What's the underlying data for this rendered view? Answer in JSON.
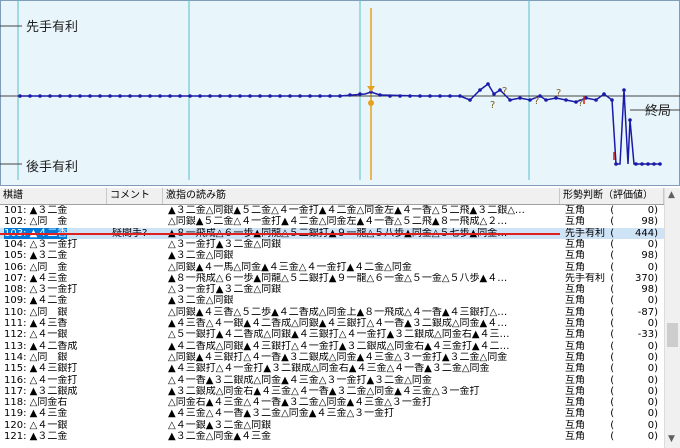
{
  "graph": {
    "label_top": "先手有利",
    "label_bottom": "後手有利",
    "label_end": "終局"
  },
  "table": {
    "headers": [
      "棋譜",
      "コメント",
      "激指の読み筋",
      "形勢判断（評価値）"
    ],
    "rows": [
      {
        "move": "101: ▲３二金",
        "comment": "",
        "pv": "▲３二金△同銀▲５二金△４一金打▲４二金△同金左▲４一香△５二飛▲３二銀△…",
        "eval": "互角",
        "num": "0"
      },
      {
        "move": "102: △同　金",
        "comment": "",
        "pv": "△同銀▲５二金△４一金打▲４二金△同金左▲４一香△５二飛▲８一飛成△２…",
        "eval": "互角",
        "num": "98"
      },
      {
        "move": "103: ▲４二香",
        "comment": "疑問手?",
        "pv": "▲８一飛成△６一歩▲同龍△５二銀打▲９一龍△５八歩▲同金△５七歩▲同金…",
        "eval": "先手有利",
        "num": "444",
        "selected": true
      },
      {
        "move": "104: △３一金打",
        "comment": "",
        "pv": "△３一金打▲３二金△同銀",
        "eval": "互角",
        "num": "0"
      },
      {
        "move": "105: ▲３二金",
        "comment": "",
        "pv": "▲３二金△同銀",
        "eval": "互角",
        "num": "98"
      },
      {
        "move": "106: △同　金",
        "comment": "",
        "pv": "△同銀▲４一馬△同金▲４三金△４一金打▲４二金△同金",
        "eval": "互角",
        "num": "0"
      },
      {
        "move": "107: ▲４三金",
        "comment": "",
        "pv": "▲８一飛成△６一歩▲同龍△５二銀打▲９一龍△６一金△５一金△５八歩▲４…",
        "eval": "先手有利",
        "num": "370"
      },
      {
        "move": "108: △３一金打",
        "comment": "",
        "pv": "△３一金打▲３二金△同銀",
        "eval": "互角",
        "num": "98"
      },
      {
        "move": "109: ▲４二金",
        "comment": "",
        "pv": "▲３二金△同銀",
        "eval": "互角",
        "num": "0"
      },
      {
        "move": "110: △同　銀",
        "comment": "",
        "pv": "△同銀▲４三香△５二歩▲４二香成△同金上▲８一飛成△４一香▲４三銀打△…",
        "eval": "互角",
        "num": "-87"
      },
      {
        "move": "111: ▲４三香",
        "comment": "",
        "pv": "▲４三香△４一銀▲４二香成△同銀▲４三銀打△４一香▲３二銀成△同金▲４…",
        "eval": "互角",
        "num": "0"
      },
      {
        "move": "112: △４一銀",
        "comment": "",
        "pv": "△５一銀打▲４二香成△同銀▲４三銀打△４一金打▲３二銀成△同金右▲４三…",
        "eval": "互角",
        "num": "-33"
      },
      {
        "move": "113: ▲４二香成",
        "comment": "",
        "pv": "▲４二香成△同銀▲４三銀打△４一金打▲３二銀成△同金右▲４三金打▲４二…",
        "eval": "互角",
        "num": "0"
      },
      {
        "move": "114: △同　銀",
        "comment": "",
        "pv": "△同銀▲４三銀打△４一香▲３二銀成△同金▲４三金△３一金打▲３二金△同金",
        "eval": "互角",
        "num": "0"
      },
      {
        "move": "115: ▲４三銀打",
        "comment": "",
        "pv": "▲４三銀打△４一金打▲３二銀成△同金右▲４三金△４一香▲３二金△同金",
        "eval": "互角",
        "num": "0"
      },
      {
        "move": "116: △４一金打",
        "comment": "",
        "pv": "△４一香▲３二銀成△同金▲４三金△３一金打▲３二金△同金",
        "eval": "互角",
        "num": "0"
      },
      {
        "move": "117: ▲３二銀成",
        "comment": "",
        "pv": "▲３二銀成△同金右▲４三金△４一香▲３二金△同金▲４三金△３一金打",
        "eval": "互角",
        "num": "0"
      },
      {
        "move": "118: △同金右",
        "comment": "",
        "pv": "△同金右▲４三金△４一香▲３二金△同金▲４三金△３一金打",
        "eval": "互角",
        "num": "0"
      },
      {
        "move": "119: ▲４三金",
        "comment": "",
        "pv": "▲４三金△４一香▲３二金△同金▲４三金△３一金打",
        "eval": "互角",
        "num": "0"
      },
      {
        "move": "120: △４一銀",
        "comment": "",
        "pv": "△４一銀▲３二金△同銀",
        "eval": "互角",
        "num": "0"
      },
      {
        "move": "121: ▲３二金",
        "comment": "",
        "pv": "▲３二金△同金▲４三金",
        "eval": "互角",
        "num": "0"
      }
    ]
  },
  "colors": {
    "graph_bg": "#e8f6fb",
    "line": "#1a1aa8",
    "marker": "#e8a020",
    "selection": "#0078d7",
    "redline": "#e02020"
  },
  "icons": {
    "scroll_up": "scroll-up-icon",
    "scroll_down": "scroll-down-icon"
  }
}
